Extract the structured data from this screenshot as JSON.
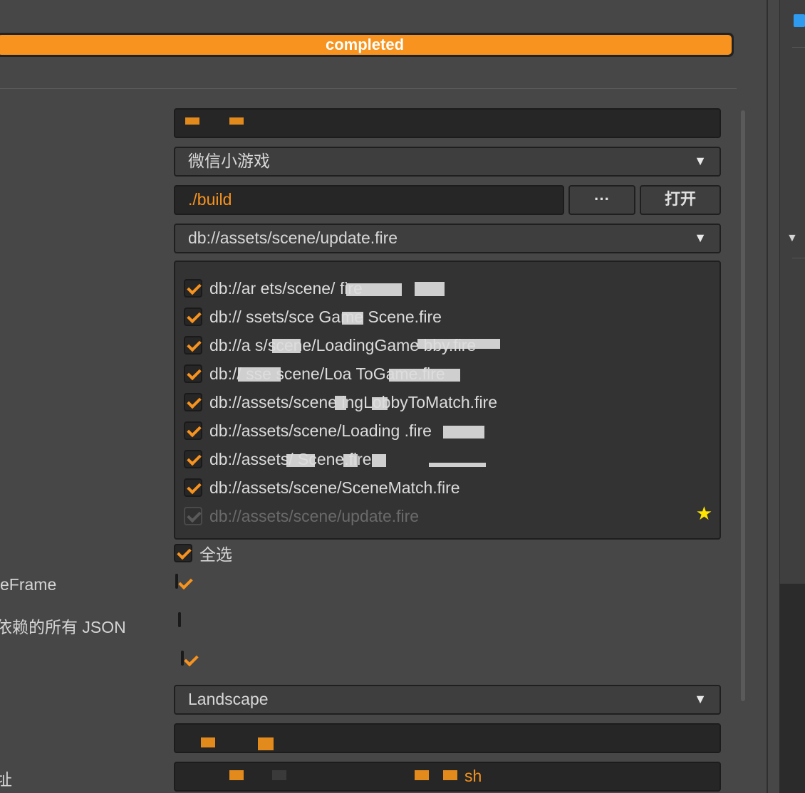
{
  "build": {
    "progress_label": "completed",
    "progress_percent": 100
  },
  "form": {
    "platform_value": "微信小游戏",
    "build_path_value": "./build",
    "browse_label": "···",
    "open_label": "打开",
    "start_scene_value": "db://assets/scene/update.fire",
    "select_all_label": "全选",
    "label_frame": "eFrame",
    "label_json": "依赖的所有 JSON",
    "orientation_value": "Landscape",
    "remote_value_suffix": "sh",
    "label_address": "址"
  },
  "scenes": [
    {
      "text": "db://ar  ets/scene/        fire",
      "checked": true
    },
    {
      "text": "db://  ssets/sce    Game Scene.fire",
      "checked": true
    },
    {
      "text": "db://a    s/scene/LoadingGame     bby.fire",
      "checked": true
    },
    {
      "text": "db://  sse  scene/Loa       ToGame.fire",
      "checked": true
    },
    {
      "text": "db://assets/scene    ingLobbyToMatch.fire",
      "checked": true
    },
    {
      "text": "db://assets/scene/Loading      .fire",
      "checked": true
    },
    {
      "text": "db://assets/       Scene.fire",
      "checked": true
    },
    {
      "text": "db://assets/scene/SceneMatch.fire",
      "checked": true
    },
    {
      "text": "db://assets/scene/update.fire",
      "checked": true,
      "disabled": true
    }
  ],
  "colors": {
    "accent": "#f7931e",
    "star": "#ffe600",
    "panel_bg": "#474747"
  },
  "icons": {
    "star": "star-icon",
    "dropdown": "triangle-down-icon",
    "check": "checkmark-icon"
  }
}
